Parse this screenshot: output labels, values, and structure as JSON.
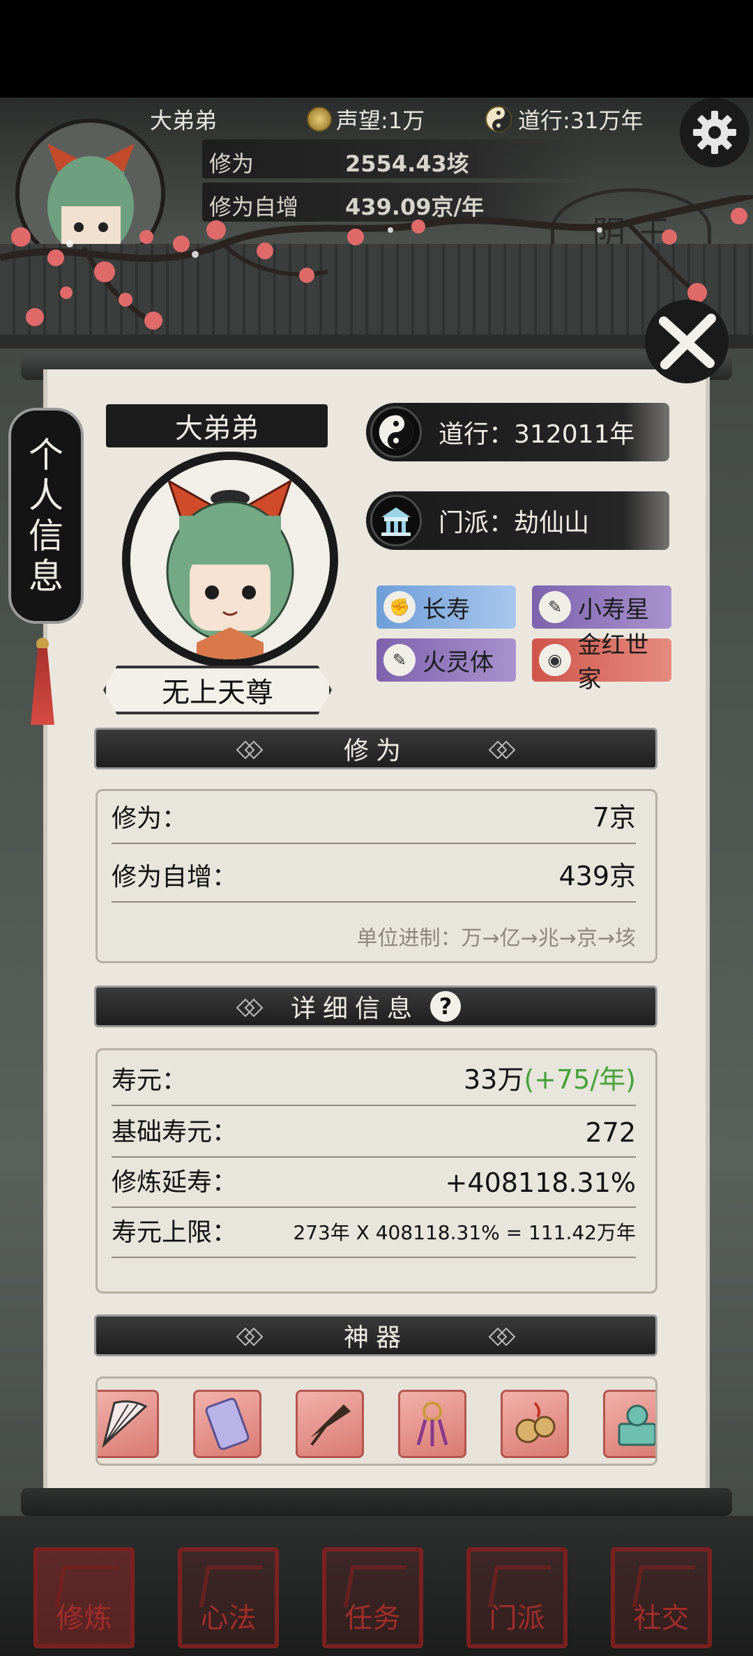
{
  "hud": {
    "player_name": "大弟弟",
    "reputation": "声望:1万",
    "daoxing": "道行:31万年",
    "cultivation_label": "修为",
    "cultivation_value": "2554.43垓",
    "growth_label": "修为自增",
    "growth_value": "439.09京/年",
    "stamp_text": "阴 王"
  },
  "side_tab": {
    "chars": [
      "个",
      "人",
      "信",
      "息"
    ]
  },
  "profile": {
    "name": "大弟弟",
    "title": "无上天尊",
    "daoxing": "道行：312011年",
    "sect": "门派：劫仙山",
    "tags": [
      {
        "label": "长寿",
        "color": "blue",
        "icon": "fist-icon"
      },
      {
        "label": "小寿星",
        "color": "purple",
        "icon": "scroll-icon"
      },
      {
        "label": "火灵体",
        "color": "purple",
        "icon": "scroll-icon"
      },
      {
        "label": "金红世家",
        "color": "red",
        "icon": "pouch-icon"
      }
    ]
  },
  "cultivation": {
    "header": "修为",
    "rows": [
      {
        "key": "修为：",
        "value": "7京"
      },
      {
        "key": "修为自增：",
        "value": "439京"
      }
    ],
    "unit_note": "单位进制：万→亿→兆→京→垓"
  },
  "details": {
    "header": "详细信息",
    "help": "?",
    "lifespan_key": "寿元：",
    "lifespan_value": "33万",
    "lifespan_rate": "(+75/年)",
    "base_key": "基础寿元：",
    "base_value": "272",
    "extend_key": "修炼延寿：",
    "extend_value": "+408118.31%",
    "limit_key": "寿元上限：",
    "limit_value": "273年 X 408118.31% = 111.42万年"
  },
  "artifacts": {
    "header": "神器",
    "items": [
      "fan-icon",
      "jade-slip-icon",
      "umbrella-icon",
      "tassel-charm-icon",
      "bells-icon",
      "seal-icon"
    ]
  },
  "nav": [
    {
      "label": "修炼",
      "active": true
    },
    {
      "label": "心法",
      "active": false
    },
    {
      "label": "任务",
      "active": false
    },
    {
      "label": "门派",
      "active": false
    },
    {
      "label": "社交",
      "active": false
    }
  ]
}
